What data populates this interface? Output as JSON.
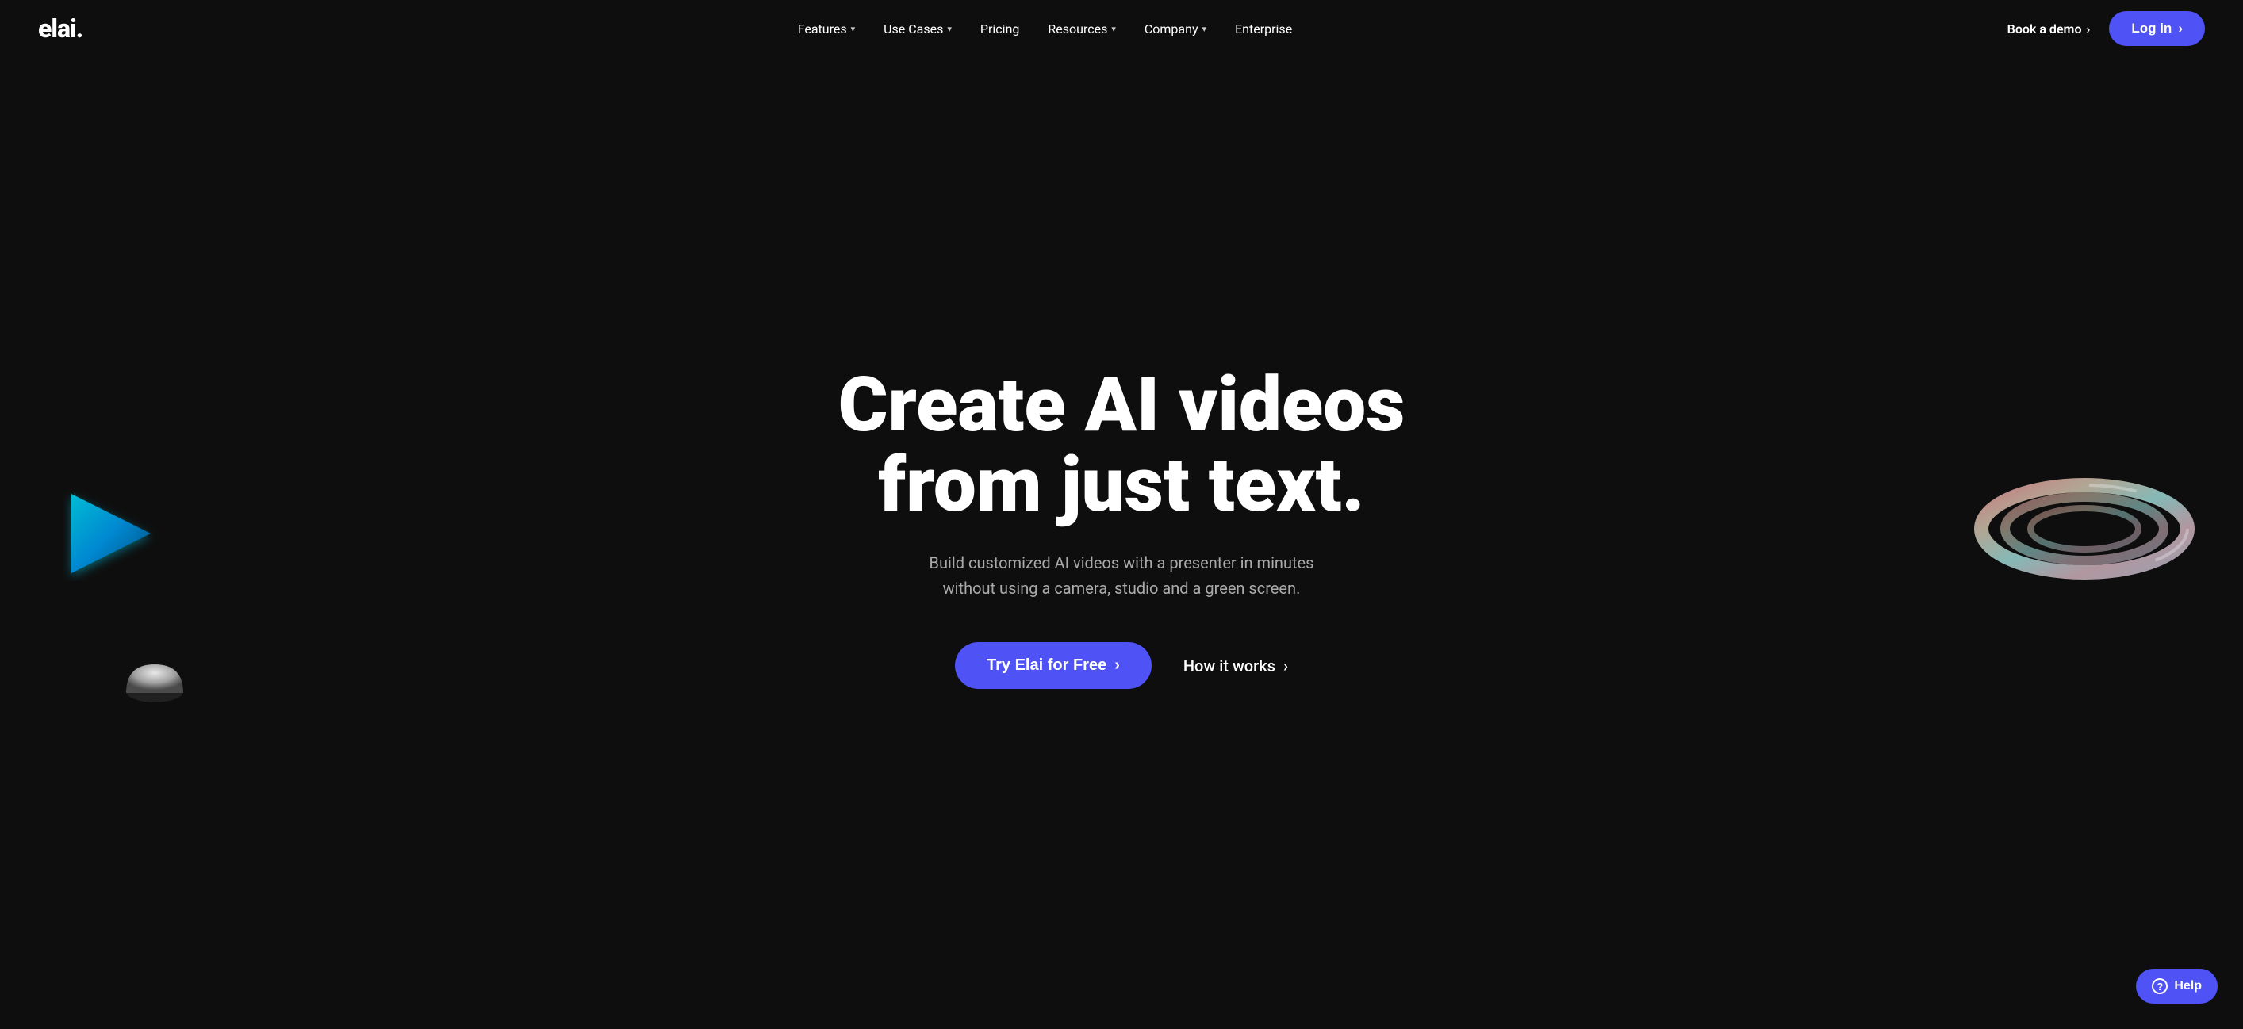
{
  "brand": {
    "logo": "elai."
  },
  "nav": {
    "items": [
      {
        "label": "Features",
        "has_dropdown": true
      },
      {
        "label": "Use Cases",
        "has_dropdown": true
      },
      {
        "label": "Pricing",
        "has_dropdown": false
      },
      {
        "label": "Resources",
        "has_dropdown": true
      },
      {
        "label": "Company",
        "has_dropdown": true
      },
      {
        "label": "Enterprise",
        "has_dropdown": false
      }
    ],
    "book_demo_label": "Book a demo",
    "login_label": "Log in"
  },
  "hero": {
    "title_line1": "Create AI videos",
    "title_line2": "from just text.",
    "subtitle": "Build customized AI videos with a presenter in minutes without using a camera, studio and a green screen.",
    "cta_primary": "Try Elai for Free",
    "cta_secondary": "How it works"
  },
  "help": {
    "label": "Help"
  },
  "colors": {
    "accent": "#4f52f5",
    "bg": "#0e0e0e",
    "text_primary": "#ffffff",
    "text_secondary": "#aaaaaa"
  }
}
